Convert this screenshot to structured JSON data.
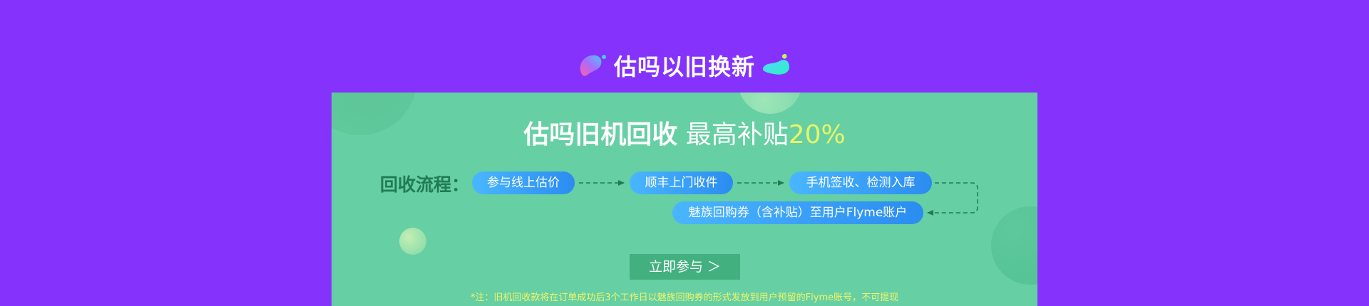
{
  "section": {
    "title": "估吗以旧换新"
  },
  "panel": {
    "headline_strong": "估吗旧机回收",
    "headline_light": " 最高补贴",
    "headline_percent": "20%",
    "flow_label": "回收流程：",
    "steps": [
      {
        "label": "参与线上估价"
      },
      {
        "label": "顺丰上门收件"
      },
      {
        "label": "手机签收、检测入库"
      },
      {
        "label": "魅族回购券（含补贴）至用户Flyme账户"
      }
    ],
    "cta_label": "立即参与 ＞",
    "note": "*注：旧机回收款将在订单成功后3个工作日以魅族回购券的形式发放到用户预留的Flyme账号，不可提现"
  },
  "colors": {
    "page_background": "#8432fc",
    "panel_background": "#66cfa3",
    "pill_gradient_start": "#4ab6ff",
    "pill_gradient_end": "#2b8cf0",
    "highlight_yellow": "#e8f56a",
    "flow_label_green": "#217a56",
    "cta_background": "#43b07f"
  },
  "icons": {
    "title_left": "gradient-blob-icon",
    "title_right": "gradient-blob-icon",
    "flow_arrow": "dashed-arrow-icon"
  }
}
